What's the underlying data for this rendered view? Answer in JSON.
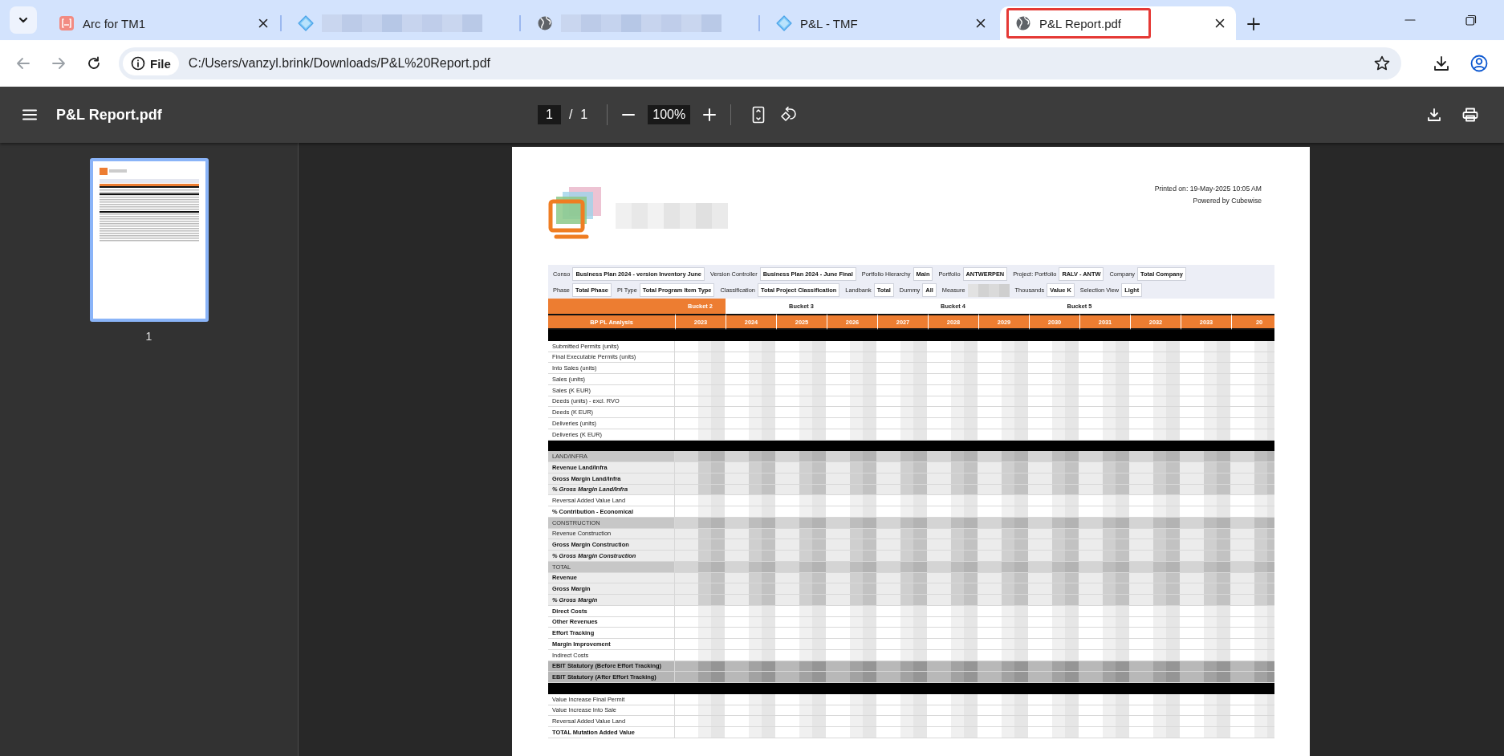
{
  "tabs": [
    {
      "kind": "app",
      "title": "Arc for TM1",
      "selected": false,
      "highlighted": false
    },
    {
      "kind": "diamond",
      "selected": false,
      "highlighted": false
    },
    {
      "kind": "globe",
      "selected": false,
      "highlighted": false
    },
    {
      "kind": "diamond",
      "title": "P&L - TMF",
      "selected": false,
      "highlighted": false
    },
    {
      "kind": "globe",
      "title": "P&L Report.pdf",
      "selected": true,
      "highlighted": true
    }
  ],
  "address_bar": {
    "chip": "File",
    "url": "C:/Users/vanzyl.brink/Downloads/P&L%20Report.pdf"
  },
  "pdf_toolbar": {
    "title": "P&L Report.pdf",
    "page": "1",
    "separator": "/",
    "page_count": "1",
    "zoom": "100%"
  },
  "sidebar": {
    "thumbnails": [
      {
        "label": "1",
        "selected": true
      }
    ]
  },
  "report": {
    "printed_on": "Printed on: 19-May-2025 10:05 AM",
    "powered_by": "Powered by Cubewise",
    "filters": [
      [
        {
          "label": "Conso",
          "value": "Business Plan 2024 - version Inventory June"
        },
        {
          "label": "Version Controller",
          "value": "Business Plan 2024 - June Final"
        },
        {
          "label": "Portfolio Hierarchy",
          "value": "Main"
        },
        {
          "label": "Portfolio",
          "value": "ANTWERPEN"
        },
        {
          "label": "Project: Portfolio",
          "value": "RALV - ANTW"
        },
        {
          "label": "Company",
          "value": "Total Company"
        }
      ],
      [
        {
          "label": "Phase",
          "value": "Total Phase"
        },
        {
          "label": "PI Type",
          "value": "Total Program Item Type"
        },
        {
          "label": "Classification",
          "value": "Total Project Classification"
        },
        {
          "label": "Landbank",
          "value": "Total"
        },
        {
          "label": "Dummy",
          "value": "All"
        },
        {
          "label": "Measure"
        },
        {
          "label": "Thousands",
          "value": "Value K"
        },
        {
          "label": "Selection View",
          "value": "Light"
        }
      ]
    ],
    "buckets": [
      {
        "label": "Bucket 2",
        "selected": true
      },
      {
        "label": "Bucket 3",
        "selected": false
      },
      {
        "label": "Bucket 4",
        "selected": false
      },
      {
        "label": "Bucket 5",
        "selected": false
      }
    ],
    "row_header": "BP PL Analysis",
    "years": [
      "2023",
      "2024",
      "2025",
      "2026",
      "2027",
      "2028",
      "2029",
      "2030",
      "2031",
      "2032",
      "2033",
      "20"
    ],
    "rows": [
      {
        "kind": "separator"
      },
      {
        "kind": "normal",
        "label": "Submitted Permits (units)",
        "shaded": false
      },
      {
        "kind": "normal",
        "label": "Final Executable Permits (units)",
        "shaded": false
      },
      {
        "kind": "normal",
        "label": "Into Sales (units)",
        "shaded": false
      },
      {
        "kind": "normal",
        "label": "Sales (units)",
        "shaded": false
      },
      {
        "kind": "normal",
        "label": "Sales (K EUR)",
        "shaded": false
      },
      {
        "kind": "normal",
        "label": "Deeds (units) - excl. RVO",
        "shaded": false
      },
      {
        "kind": "normal",
        "label": "Deeds (K EUR)",
        "shaded": false
      },
      {
        "kind": "normal",
        "label": "Deliveries (units)",
        "shaded": false
      },
      {
        "kind": "normal",
        "label": "Deliveries (K EUR)",
        "shaded": false
      },
      {
        "kind": "separator"
      },
      {
        "kind": "section",
        "label": "LAND/INFRA"
      },
      {
        "kind": "bold",
        "label": "Revenue Land/Infra",
        "shaded": true
      },
      {
        "kind": "bold",
        "label": "Gross Margin Land/Infra",
        "shaded": true
      },
      {
        "kind": "bolditalic",
        "label": "% Gross Margin Land/Infra",
        "shaded": true
      },
      {
        "kind": "normal",
        "label": "Reversal Added Value Land",
        "shaded": false
      },
      {
        "kind": "bold",
        "label": "% Contribution - Economical",
        "shaded": false
      },
      {
        "kind": "section",
        "label": "CONSTRUCTION"
      },
      {
        "kind": "normal",
        "label": "Revenue Construction",
        "shaded": true
      },
      {
        "kind": "bold",
        "label": "Gross Margin Construction",
        "shaded": true
      },
      {
        "kind": "bolditalic",
        "label": "% Gross Margin Construction",
        "shaded": true
      },
      {
        "kind": "section",
        "label": "TOTAL"
      },
      {
        "kind": "bold",
        "label": "Revenue",
        "shaded": true
      },
      {
        "kind": "bold",
        "label": "Gross Margin",
        "shaded": true
      },
      {
        "kind": "bolditalic",
        "label": "% Gross Margin",
        "shaded": true
      },
      {
        "kind": "bold",
        "label": "Direct Costs",
        "shaded": false
      },
      {
        "kind": "bold",
        "label": "Other Revenues",
        "shaded": false
      },
      {
        "kind": "bold",
        "label": "Effort Tracking",
        "shaded": false
      },
      {
        "kind": "bold",
        "label": "Margin Improvement",
        "shaded": false
      },
      {
        "kind": "normal",
        "label": "Indirect Costs",
        "shaded": false
      },
      {
        "kind": "total",
        "label": "EBIT Statutory (Before Effort Tracking)"
      },
      {
        "kind": "total",
        "label": "EBIT Statutory (After Effort Tracking)"
      },
      {
        "kind": "separator"
      },
      {
        "kind": "normal",
        "label": "Value Increase Final Permit",
        "shaded": false
      },
      {
        "kind": "normal",
        "label": "Value Increase Into Sale",
        "shaded": false
      },
      {
        "kind": "normal",
        "label": "Reversal Added Value Land",
        "shaded": false
      },
      {
        "kind": "bold",
        "label": "TOTAL Mutation Added Value",
        "shaded": false
      }
    ]
  }
}
